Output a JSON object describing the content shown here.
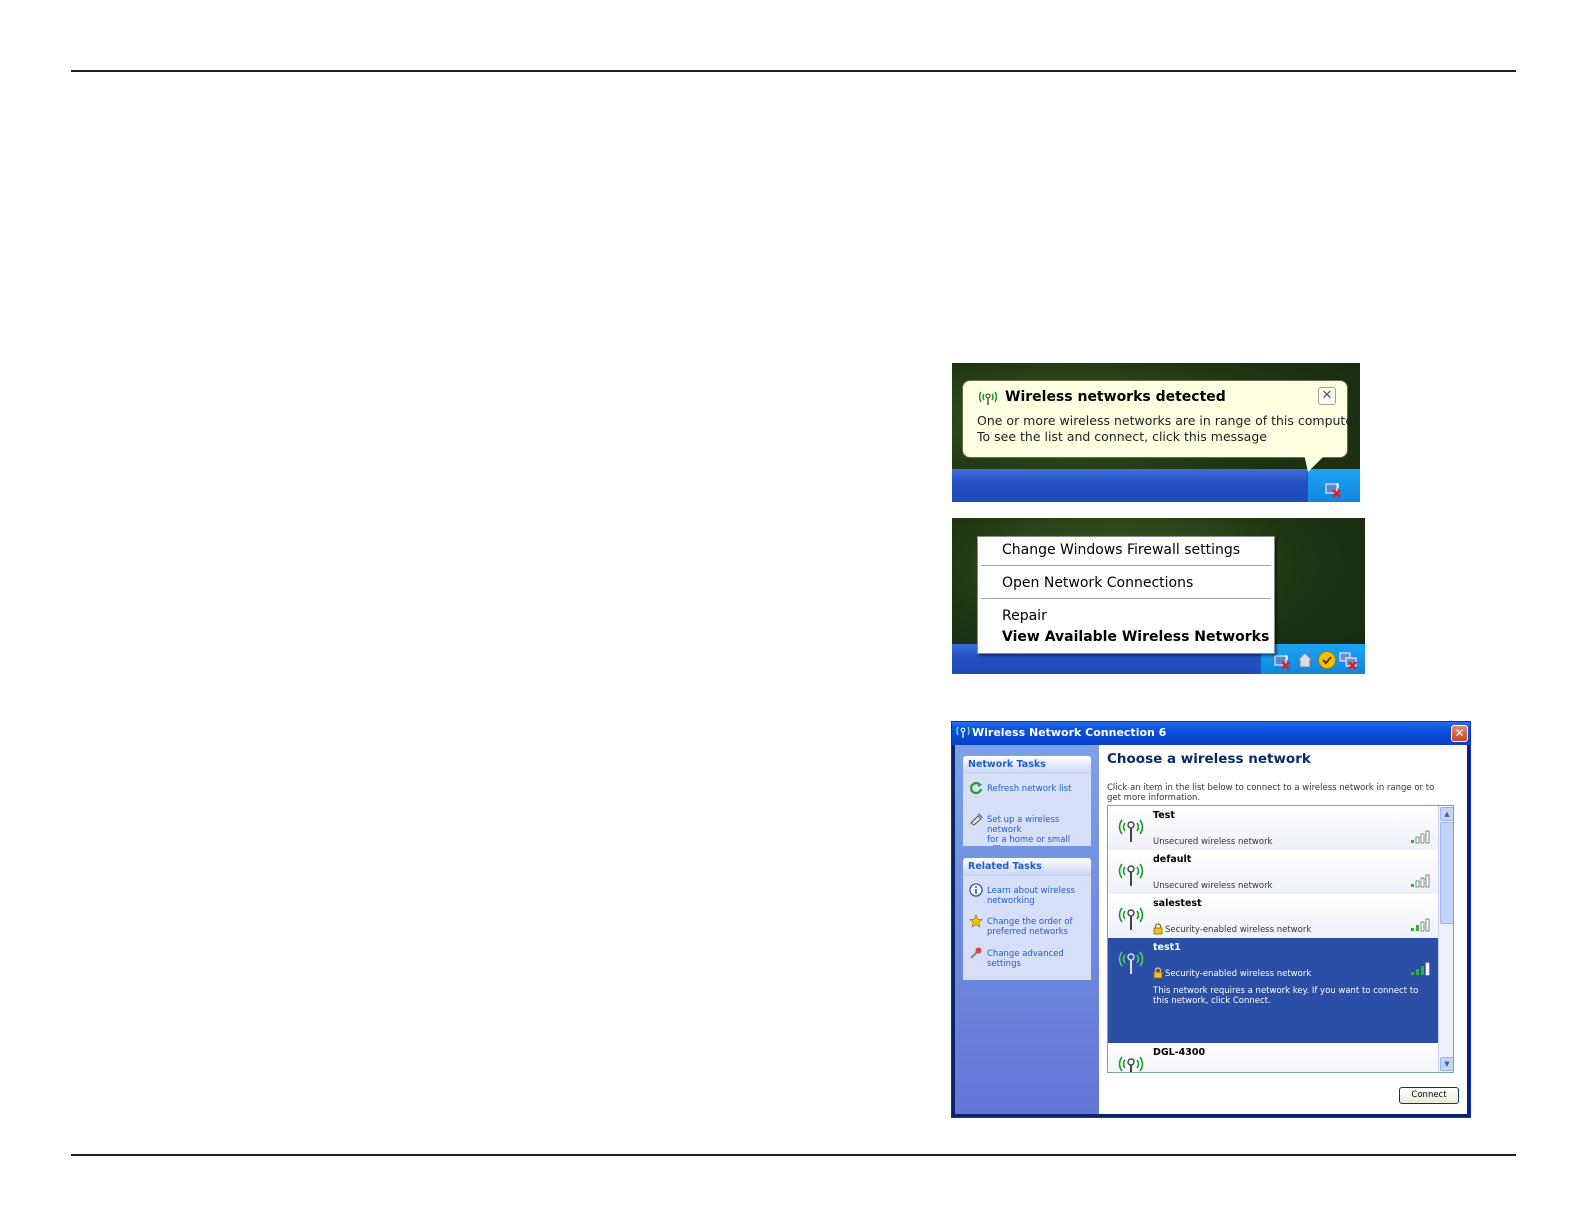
{
  "balloon": {
    "title": "Wireless networks detected",
    "line1": "One or more wireless networks are in range of this computer.",
    "line2": "To see the list and connect, click this message",
    "close": "✕"
  },
  "context_menu": {
    "items": [
      "Change Windows Firewall settings",
      "Open Network Connections",
      "Repair",
      "View Available Wireless Networks"
    ]
  },
  "dialog": {
    "title": "Wireless Network Connection 6",
    "close": "✕",
    "network_tasks": {
      "header": "Network Tasks",
      "links": [
        "Refresh network list",
        "Set up a wireless network\nfor a home or small office"
      ]
    },
    "related_tasks": {
      "header": "Related Tasks",
      "links": [
        "Learn about wireless\nnetworking",
        "Change the order of\npreferred networks",
        "Change advanced\nsettings"
      ]
    },
    "heading": "Choose a wireless network",
    "description": "Click an item in the list below to connect to a wireless network in range or to get more information.",
    "networks": [
      {
        "name": "Test",
        "type": "Unsecured wireless network"
      },
      {
        "name": "default",
        "type": "Unsecured wireless network"
      },
      {
        "name": "salestest",
        "type": "Security-enabled wireless network"
      },
      {
        "name": "test1",
        "type": "Security-enabled wireless network",
        "note": "This network requires a network key. If you want to connect to this network, click Connect."
      },
      {
        "name": "DGL-4300",
        "type": ""
      }
    ],
    "connect_label": "Connect"
  },
  "colors": {
    "rule": "#231f20",
    "balloon_bg": "#ffffe1",
    "selected_row": "#2b4fa6",
    "link": "#215dc6"
  }
}
